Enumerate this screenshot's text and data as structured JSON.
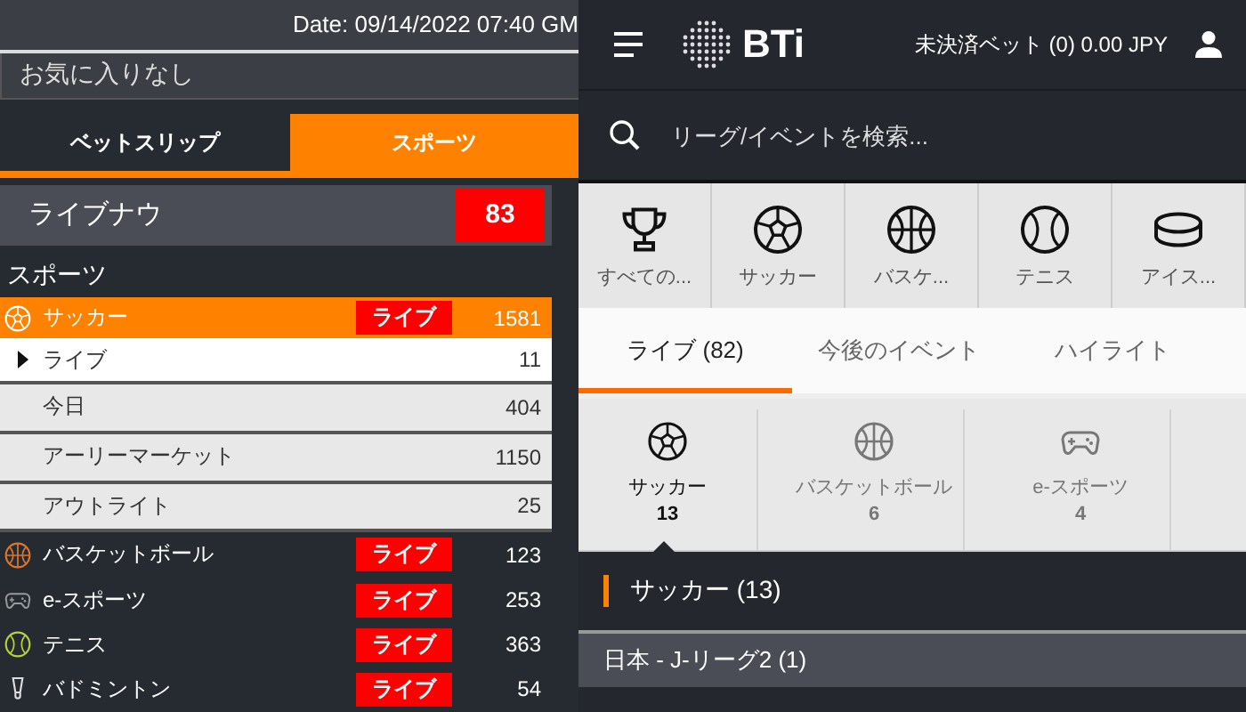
{
  "left_panel": {
    "date": "Date: 09/14/2022 07:40 GM",
    "favorites": "お気に入りなし",
    "tabs": [
      {
        "label": "ベットスリップ",
        "selected": false
      },
      {
        "label": "スポーツ",
        "selected": true
      }
    ],
    "live_now": {
      "label": "ライブナウ",
      "count": "83"
    },
    "sports_heading": "スポーツ",
    "sports": [
      {
        "kind": "soccer",
        "name": "サッカー",
        "badge": "ライブ",
        "count": "1581",
        "expanded": true,
        "children": [
          {
            "name": "ライブ",
            "count": "11",
            "selected": true
          },
          {
            "name": "今日",
            "count": "404",
            "selected": false
          },
          {
            "name": "アーリーマーケット",
            "count": "1150",
            "selected": false
          },
          {
            "name": "アウトライト",
            "count": "25",
            "selected": false
          }
        ]
      },
      {
        "kind": "basketball",
        "name": "バスケットボール",
        "badge": "ライブ",
        "count": "123",
        "expanded": false
      },
      {
        "kind": "esports",
        "name": "e-スポーツ",
        "badge": "ライブ",
        "count": "253",
        "expanded": false
      },
      {
        "kind": "tennis",
        "name": "テニス",
        "badge": "ライブ",
        "count": "363",
        "expanded": false
      },
      {
        "kind": "badminton",
        "name": "バドミントン",
        "badge": "ライブ",
        "count": "54",
        "expanded": false
      }
    ]
  },
  "right_panel": {
    "header": {
      "logo": "BTi",
      "open_bets": "未決済ベット (0) 0.00 JPY"
    },
    "search": {
      "placeholder": "リーグ/イベントを検索..."
    },
    "sport_icons": [
      {
        "kind": "trophy",
        "label": "すべての..."
      },
      {
        "kind": "soccer",
        "label": "サッカー"
      },
      {
        "kind": "basketball",
        "label": "バスケ..."
      },
      {
        "kind": "tennis",
        "label": "テニス"
      },
      {
        "kind": "hockey",
        "label": "アイス..."
      }
    ],
    "tabs": [
      {
        "label": "ライブ (82)",
        "selected": true
      },
      {
        "label": "今後のイベント",
        "selected": false
      },
      {
        "label": "ハイライト",
        "selected": false
      }
    ],
    "live_sports": [
      {
        "kind": "soccer",
        "name": "サッカー",
        "count": "13",
        "selected": true
      },
      {
        "kind": "basketball",
        "name": "バスケットボール",
        "count": "6",
        "selected": false
      },
      {
        "kind": "esports",
        "name": "e-スポーツ",
        "count": "4",
        "selected": false
      }
    ],
    "section": "サッカー (13)",
    "league": "日本 - J-リーグ2 (1)"
  }
}
